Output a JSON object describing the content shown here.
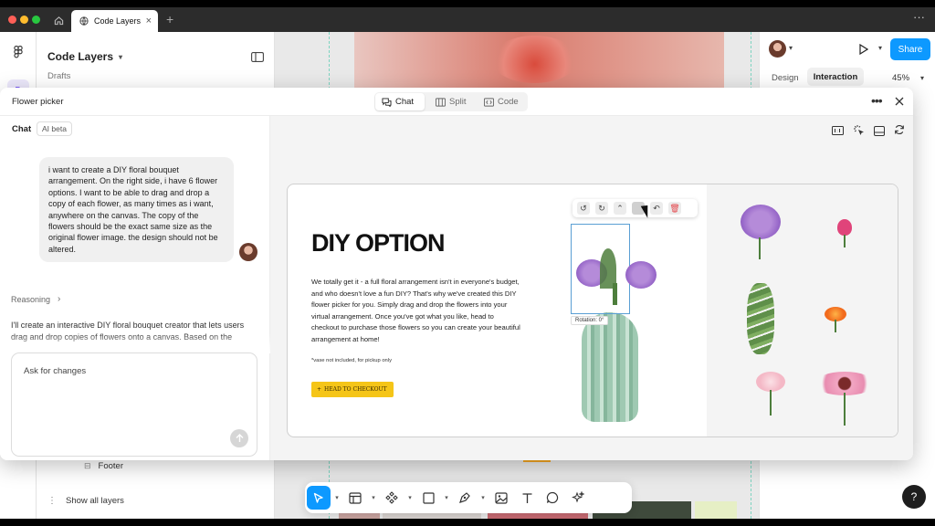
{
  "browser": {
    "tab_label": "Code Layers",
    "new_tab": "+",
    "menu": "···"
  },
  "editor": {
    "project_title": "Code Layers",
    "project_sub": "Drafts",
    "right_tabs": [
      "Design",
      "Interaction"
    ],
    "zoom": "45%",
    "share_label": "Share",
    "layer_footer": "Footer",
    "show_all_layers": "Show all layers",
    "help": "?"
  },
  "modal": {
    "title": "Flower picker",
    "view_tabs": [
      "Chat",
      "Split",
      "Code"
    ],
    "active_view": "Chat"
  },
  "chat": {
    "header": "Chat",
    "badge": "AI beta",
    "user_message": "i want to create a DIY floral bouquet arrangement. On the right side, i have 6 flower options. I want to be able to drag and drop a copy of each flower, as many times as i want, anywhere on the canvas. The copy of the flowers should be the exact same size as the original flower image. the design should not be altered.",
    "reasoning_label": "Reasoning",
    "assistant_message": "I'll create an interactive DIY floral bouquet creator that lets users drag and drop copies of flowers onto a canvas. Based on the design, I'll need to:",
    "input_placeholder": "Ask for changes"
  },
  "preview": {
    "heading": "DIY OPTION",
    "body": "We totally get it - a full floral arrangement isn't in everyone's budget, and who doesn't love a fun DIY? That's why we've created this DIY flower picker for you. Simply drag and drop the flowers into your virtual arrangement. Once you've got what you like, head to checkout to purchase those flowers so you can create your beautiful arrangement at home!",
    "note": "*vase not included, for pickup only",
    "cta": "HEAD TO CHECKOUT",
    "rotation": "Rotation: 0°"
  },
  "colors": {
    "accent": "#0d99ff",
    "cta": "#f5c518",
    "share": "#0d99ff",
    "delete": "#e5484d"
  }
}
